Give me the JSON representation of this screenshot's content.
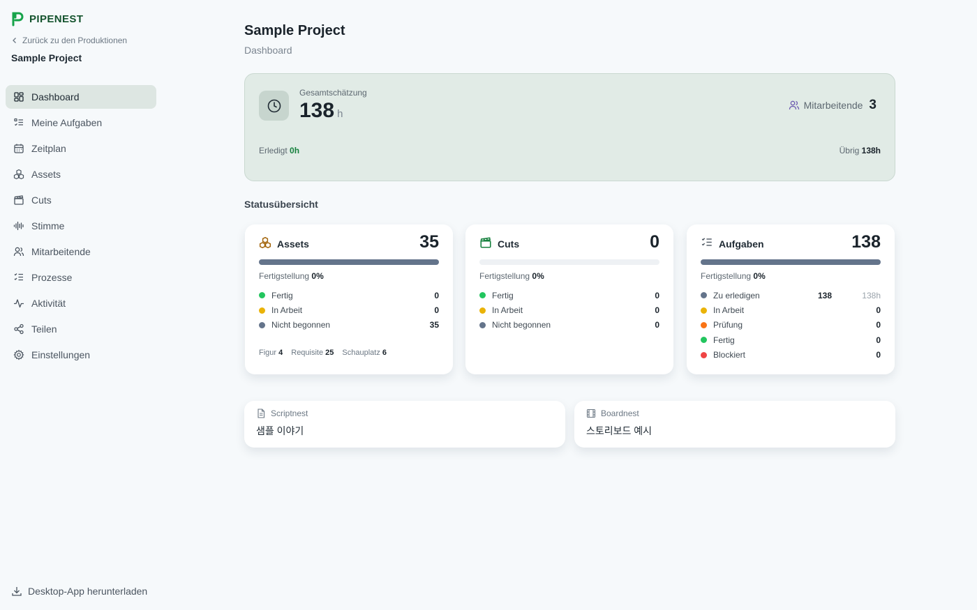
{
  "brand": {
    "name": "PIPENEST",
    "color": "#16a34a"
  },
  "sidebar": {
    "back_label": "Zurück zu den Produktionen",
    "project_name": "Sample Project",
    "items": [
      {
        "label": "Dashboard",
        "icon": "dashboard-icon",
        "active": true
      },
      {
        "label": "Meine Aufgaben",
        "icon": "task-list-icon"
      },
      {
        "label": "Zeitplan",
        "icon": "calendar-icon"
      },
      {
        "label": "Assets",
        "icon": "boxes-icon"
      },
      {
        "label": "Cuts",
        "icon": "clapperboard-icon"
      },
      {
        "label": "Stimme",
        "icon": "audio-waveform-icon"
      },
      {
        "label": "Mitarbeitende",
        "icon": "users-icon"
      },
      {
        "label": "Prozesse",
        "icon": "checklist-icon"
      },
      {
        "label": "Aktivität",
        "icon": "activity-icon"
      },
      {
        "label": "Teilen",
        "icon": "share-icon"
      },
      {
        "label": "Einstellungen",
        "icon": "gear-icon"
      }
    ],
    "download_label": "Desktop-App herunterladen"
  },
  "header": {
    "title": "Sample Project",
    "subtitle": "Dashboard"
  },
  "summary": {
    "estimate_label": "Gesamtschätzung",
    "estimate_value": "138",
    "estimate_unit": "h",
    "staff_label": "Mitarbeitende",
    "staff_count": "3",
    "done_label": "Erledigt",
    "done_value": "0h",
    "remaining_label": "Übrig",
    "remaining_value": "138h"
  },
  "status_title": "Statusübersicht",
  "cards": {
    "assets": {
      "title": "Assets",
      "count": "35",
      "progress": 0,
      "completion_label": "Fertigstellung",
      "completion_value": "0%",
      "rows": [
        {
          "label": "Fertig",
          "value": "0",
          "color": "#22c55e"
        },
        {
          "label": "In Arbeit",
          "value": "0",
          "color": "#eab308"
        },
        {
          "label": "Nicht begonnen",
          "value": "35",
          "color": "#64748b"
        }
      ],
      "types": [
        {
          "label": "Figur",
          "value": "4"
        },
        {
          "label": "Requisite",
          "value": "25"
        },
        {
          "label": "Schauplatz",
          "value": "6"
        }
      ]
    },
    "cuts": {
      "title": "Cuts",
      "count": "0",
      "progress": 0,
      "completion_label": "Fertigstellung",
      "completion_value": "0%",
      "rows": [
        {
          "label": "Fertig",
          "value": "0",
          "color": "#22c55e"
        },
        {
          "label": "In Arbeit",
          "value": "0",
          "color": "#eab308"
        },
        {
          "label": "Nicht begonnen",
          "value": "0",
          "color": "#64748b"
        }
      ]
    },
    "tasks": {
      "title": "Aufgaben",
      "count": "138",
      "progress": 0,
      "completion_label": "Fertigstellung",
      "completion_value": "0%",
      "rows": [
        {
          "label": "Zu erledigen",
          "value": "138",
          "hours": "138h",
          "color": "#64748b"
        },
        {
          "label": "In Arbeit",
          "value": "0",
          "color": "#eab308"
        },
        {
          "label": "Prüfung",
          "value": "0",
          "color": "#f97316"
        },
        {
          "label": "Fertig",
          "value": "0",
          "color": "#22c55e"
        },
        {
          "label": "Blockiert",
          "value": "0",
          "color": "#ef4444"
        }
      ]
    }
  },
  "links": {
    "scriptnest": {
      "label": "Scriptnest",
      "value": "샘플 이야기"
    },
    "boardnest": {
      "label": "Boardnest",
      "value": "스토리보드 예시"
    }
  }
}
